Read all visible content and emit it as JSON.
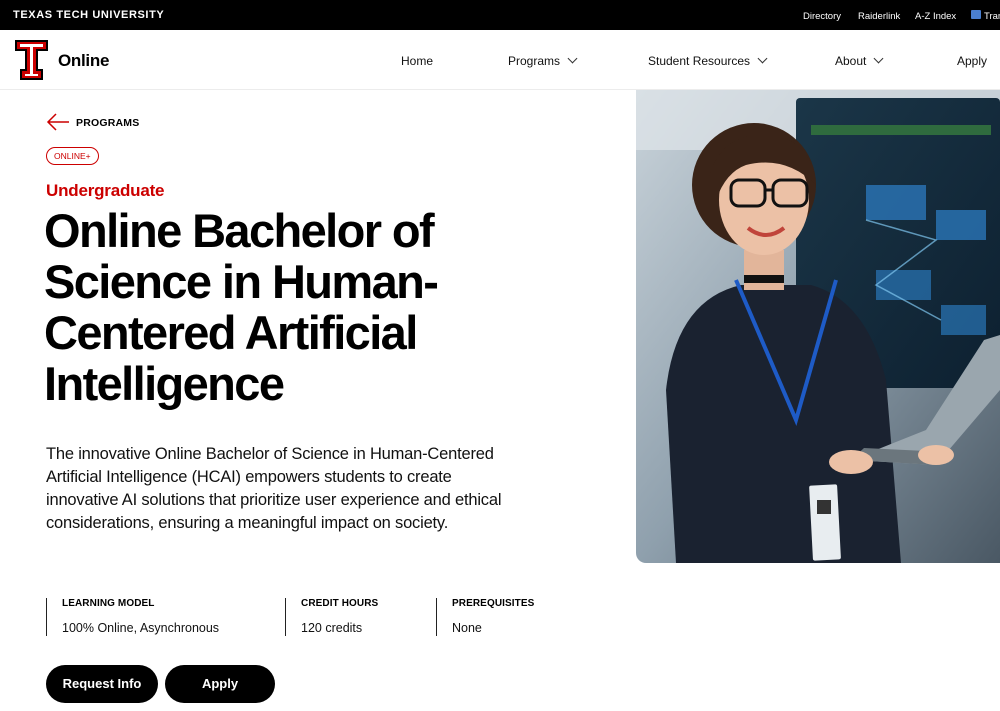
{
  "topbar": {
    "university": "TEXAS TECH UNIVERSITY",
    "links": [
      "Directory",
      "Raiderlink",
      "A-Z Index"
    ],
    "translate_label": "Tran",
    "translate_icon": "translate-flag-icon"
  },
  "header": {
    "brand": "Online",
    "logo_icon": "double-t-logo-icon",
    "nav": [
      {
        "label": "Home"
      },
      {
        "label": "Programs",
        "dropdown": true
      },
      {
        "label": "Student Resources",
        "dropdown": true
      },
      {
        "label": "About",
        "dropdown": true
      },
      {
        "label": "Apply"
      }
    ]
  },
  "program": {
    "back_label": "PROGRAMS",
    "back_icon": "arrow-left-icon",
    "badge": "ONLINE+",
    "level": "Undergraduate",
    "title_lines": [
      "Online Bachelor of",
      "Science in Human-",
      "Centered Artificial",
      "Intelligence"
    ],
    "description_lines": [
      "The innovative Online Bachelor of Science in Human-Centered",
      "Artificial Intelligence (HCAI) empowers students to create",
      "innovative AI solutions that prioritize user experience and ethical",
      "considerations, ensuring a meaningful impact on society."
    ],
    "facts": [
      {
        "label": "LEARNING MODEL",
        "value": "100% Online, Asynchronous"
      },
      {
        "label": "CREDIT HOURS",
        "value": "120 credits"
      },
      {
        "label": "PREREQUISITES",
        "value": "None"
      }
    ],
    "buttons": {
      "request_info": "Request Info",
      "apply": "Apply"
    }
  },
  "colors": {
    "accent": "#cc0000",
    "topbar": "#000000",
    "button": "#000000"
  }
}
